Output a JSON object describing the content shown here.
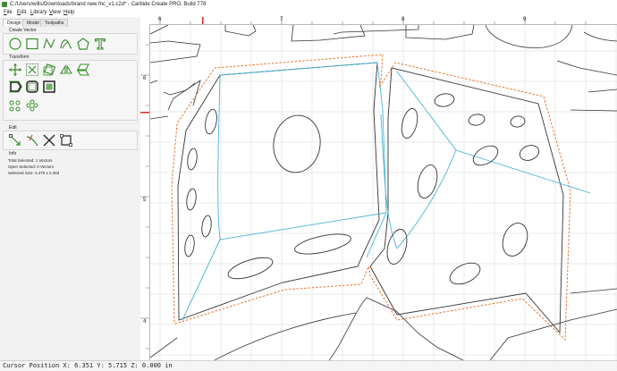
{
  "window": {
    "title": "C:/Users/wills/Downloads/brand new fnc_v1.c2d* - Carbide Create PRO, Build 778"
  },
  "menu": [
    "File",
    "Edit",
    "Library",
    "View",
    "Help"
  ],
  "tabs": [
    "Design",
    "Model",
    "Toolpaths"
  ],
  "sections": {
    "create_vector": "Create Vector",
    "transform": "Transform",
    "edit": "Edit",
    "info": "Info"
  },
  "info": {
    "total_selected": "Total Selected:  1 Vectors",
    "open_selected": "Open Selected:  0 Vectors",
    "selected_size": "Selected Size:  3.470 x 2.353"
  },
  "ruler": {
    "top": [
      "6",
      "7",
      "8",
      "9"
    ],
    "left": [
      "6",
      "5",
      "4"
    ]
  },
  "status": {
    "cursor": "Cursor Position X: 6.351 Y: 5.715 Z: 0.000 in"
  },
  "colors": {
    "tool_green": "#3c8d2f",
    "selection_cyan": "#48b4d8",
    "offset_orange": "#e8742a",
    "grid": "#e2e2e2"
  },
  "icons": {
    "create": [
      "circle-icon",
      "rectangle-icon",
      "polyline-icon",
      "curve-icon",
      "polygon-icon",
      "text-icon"
    ],
    "transform": [
      "move-icon",
      "scale-icon",
      "rotate-icon",
      "mirror-icon",
      "skew-icon",
      "offset-icon",
      "round-corner-icon",
      "boolean-icon",
      "align-icon",
      "distribute-icon"
    ],
    "edit": [
      "node-edit-icon",
      "trim-icon",
      "cut-icon",
      "join-icon"
    ]
  }
}
